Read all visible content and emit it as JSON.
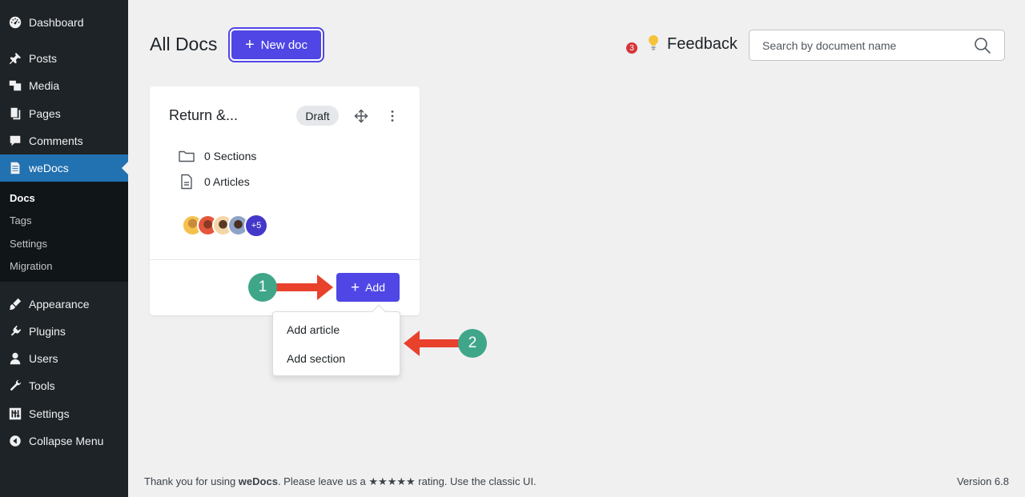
{
  "sidebar": {
    "items": [
      {
        "label": "Dashboard",
        "icon": "dashboard-icon"
      },
      {
        "label": "Posts",
        "icon": "pin-icon"
      },
      {
        "label": "Media",
        "icon": "media-icon"
      },
      {
        "label": "Pages",
        "icon": "pages-icon"
      },
      {
        "label": "Comments",
        "icon": "comment-icon"
      },
      {
        "label": "weDocs",
        "icon": "document-icon"
      },
      {
        "label": "Appearance",
        "icon": "brush-icon"
      },
      {
        "label": "Plugins",
        "icon": "plugin-icon"
      },
      {
        "label": "Users",
        "icon": "user-icon"
      },
      {
        "label": "Tools",
        "icon": "wrench-icon"
      },
      {
        "label": "Settings",
        "icon": "sliders-icon"
      },
      {
        "label": "Collapse Menu",
        "icon": "collapse-icon"
      }
    ],
    "submenu": [
      "Docs",
      "Tags",
      "Settings",
      "Migration"
    ],
    "accent_color": "#2271b1"
  },
  "header": {
    "title": "All Docs",
    "new_doc_label": "New doc",
    "feedback_count": "3",
    "feedback_label": "Feedback",
    "search_placeholder": "Search by document name",
    "button_color": "#4f46e5"
  },
  "card": {
    "title": "Return &...",
    "status": "Draft",
    "sections": "0 Sections",
    "articles": "0 Articles",
    "avatars_more": "+5",
    "add_label": "Add"
  },
  "dropdown": {
    "items": [
      "Add article",
      "Add section"
    ]
  },
  "annotations": {
    "step1": "1",
    "step2": "2",
    "badge_color": "#3fa68a",
    "arrow_color": "#e8412c"
  },
  "footer": {
    "text_before": "Thank you for using ",
    "brand": "weDocs",
    "text_after": ". Please leave us a ★★★★★ rating. Use the classic UI.",
    "version": "Version 6.8"
  }
}
